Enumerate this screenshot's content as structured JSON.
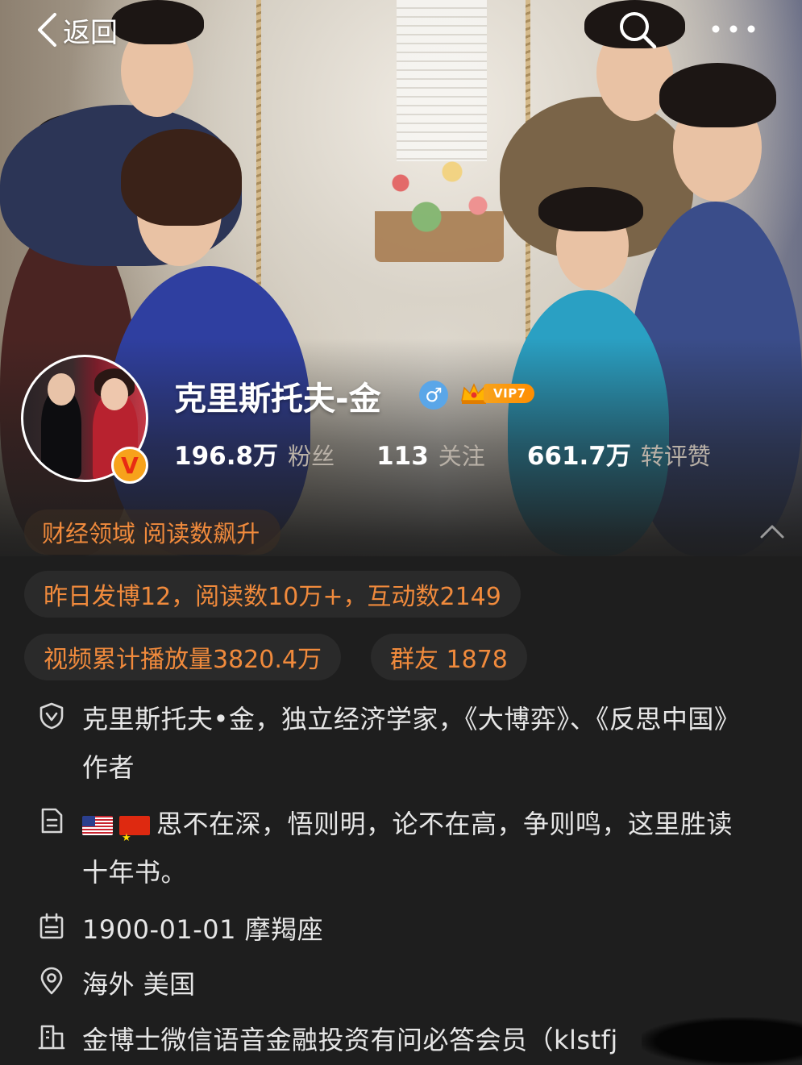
{
  "nav": {
    "back_label": "返回",
    "icons": [
      "chevron-left-icon",
      "search-icon",
      "more-icon"
    ]
  },
  "profile": {
    "name": "克里斯托夫-金",
    "gender_symbol": "♂",
    "vip_label": "VIP7",
    "verified_badge": "V",
    "stats": [
      {
        "value": "196.8万",
        "label": "粉丝"
      },
      {
        "value": "113",
        "label": "关注"
      },
      {
        "value": "661.7万",
        "label": "转评赞"
      }
    ]
  },
  "domain_badge": "财经领域 阅读数飙升",
  "pills": {
    "yesterday": "昨日发博12，阅读数10万+，互动数2149",
    "video": "视频累计播放量3820.4万",
    "group": "群友 1878"
  },
  "info": {
    "verification": "克里斯托夫•金，独立经济学家，《大博弈》、《反思中国》作者",
    "bio": "思不在深，悟则明，论不在高，争则鸣，这里胜读十年书。",
    "birthday": "1900-01-01 摩羯座",
    "location": "海外 美国",
    "company": "金博士微信语音金融投资有问必答会员（klstfj"
  },
  "colors": {
    "accent_orange": "#f08a3c",
    "background": "#1e1e1e",
    "vip_gold": "#f7a31c",
    "gender_blue": "#5aa6e8"
  }
}
